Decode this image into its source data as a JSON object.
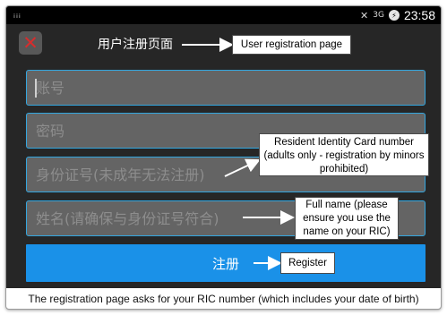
{
  "status_bar": {
    "signal": "ᵢᵢᵢ",
    "mute_glyph": "🔇",
    "network": "3G",
    "battery_glyph": "⚡",
    "time": "23:58"
  },
  "action_bar": {
    "title": "用户注册页面"
  },
  "form": {
    "account_placeholder": "账号",
    "password_placeholder": "密码",
    "id_number_placeholder": "身份证号(未成年无法注册)",
    "name_placeholder": "姓名(请确保与身份证号符合)",
    "register_label": "注册"
  },
  "annotations": {
    "title_note": "User registration page",
    "id_note": "Resident Identity Card number (adults only - registration by minors prohibited)",
    "name_note": "Full name (please ensure you use the name on your RIC)",
    "register_note": "Register"
  },
  "caption": "The registration page asks for your RIC number (which includes your date of birth)",
  "colors": {
    "field_border": "#33a6df",
    "button": "#1a91e8",
    "background": "#262626"
  }
}
